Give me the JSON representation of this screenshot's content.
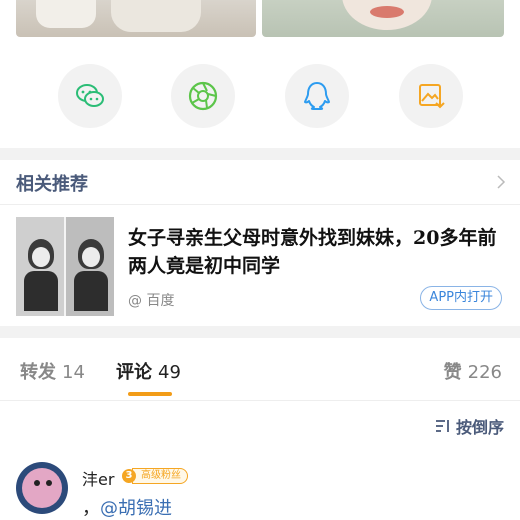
{
  "share": {
    "items": [
      {
        "icon": "wechat-icon",
        "color": "#2bbd76"
      },
      {
        "icon": "moments-icon",
        "color": "#5cc54a"
      },
      {
        "icon": "qq-icon",
        "color": "#2d9cf0"
      },
      {
        "icon": "save-image-icon",
        "color": "#f5a623"
      }
    ]
  },
  "related": {
    "title": "相关推荐",
    "card": {
      "headline": "女子寻亲生父母时意外找到妹妹，20多年前两人竟是初中同学",
      "source": "@ 百度",
      "app_button": "APP内打开"
    }
  },
  "tabs": {
    "repost": {
      "label": "转发",
      "count": "14"
    },
    "comment": {
      "label": "评论",
      "count": "49"
    },
    "like": {
      "label": "赞",
      "count": "226"
    }
  },
  "sort": {
    "label": "按倒序"
  },
  "comment": {
    "user": "沣er",
    "fan_level": "3",
    "fan_badge": "高级粉丝",
    "prefix": "，",
    "mention": "@胡锡进"
  },
  "colors": {
    "accent_orange": "#f29c18",
    "link_blue": "#3b6fb3",
    "header_text": "#4a5a7a"
  }
}
